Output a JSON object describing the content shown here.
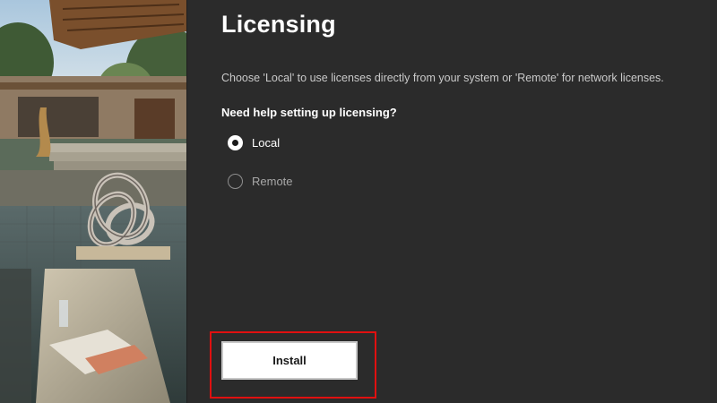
{
  "page": {
    "title": "Licensing",
    "description": "Choose 'Local' to use licenses directly from your system or 'Remote' for network licenses.",
    "question": "Need help setting up licensing?"
  },
  "options": [
    {
      "label": "Local",
      "selected": true
    },
    {
      "label": "Remote",
      "selected": false
    }
  ],
  "actions": {
    "install_label": "Install"
  },
  "colors": {
    "background": "#2b2b2b",
    "highlight": "#e01010",
    "button": "#ffffff"
  }
}
